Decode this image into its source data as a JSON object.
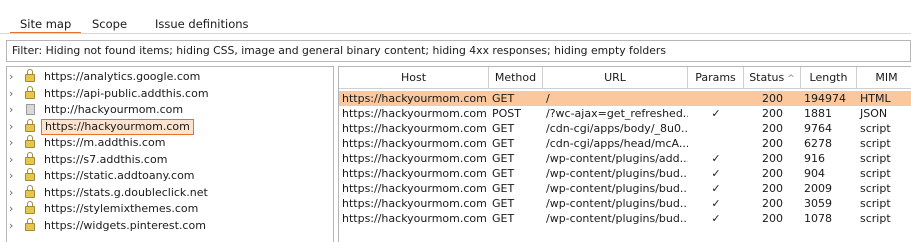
{
  "tabs": [
    {
      "label": "Site map",
      "active": true
    },
    {
      "label": "Scope",
      "active": false
    },
    {
      "label": "Issue definitions",
      "active": false
    }
  ],
  "filter": {
    "text": "Filter: Hiding not found items;  hiding CSS, image and general binary content;  hiding 4xx responses;  hiding empty folders"
  },
  "sitemap": {
    "hosts": [
      {
        "label": "https://analytics.google.com",
        "icon": "lock-icon",
        "selected": false
      },
      {
        "label": "https://api-public.addthis.com",
        "icon": "lock-icon",
        "selected": false
      },
      {
        "label": "http://hackyourmom.com",
        "icon": "page-icon",
        "selected": false
      },
      {
        "label": "https://hackyourmom.com",
        "icon": "lock-icon",
        "selected": true
      },
      {
        "label": "https://m.addthis.com",
        "icon": "lock-icon",
        "selected": false
      },
      {
        "label": "https://s7.addthis.com",
        "icon": "lock-icon",
        "selected": false
      },
      {
        "label": "https://static.addtoany.com",
        "icon": "lock-icon",
        "selected": false
      },
      {
        "label": "https://stats.g.doubleclick.net",
        "icon": "lock-icon",
        "selected": false
      },
      {
        "label": "https://stylemixthemes.com",
        "icon": "lock-icon",
        "selected": false
      },
      {
        "label": "https://widgets.pinterest.com",
        "icon": "lock-icon",
        "selected": false
      }
    ]
  },
  "requests": {
    "columns": [
      "Host",
      "Method",
      "URL",
      "Params",
      "Status",
      "Length",
      "MIM"
    ],
    "sort_indicator": "^",
    "rows": [
      {
        "host": "https://hackyourmom.com",
        "method": "GET",
        "url": "/",
        "params": "",
        "status": "200",
        "length": "194974",
        "mime": "HTML",
        "selected": true
      },
      {
        "host": "https://hackyourmom.com",
        "method": "POST",
        "url": "/?wc-ajax=get_refreshed...",
        "params": "✓",
        "status": "200",
        "length": "1881",
        "mime": "JSON",
        "selected": false
      },
      {
        "host": "https://hackyourmom.com",
        "method": "GET",
        "url": "/cdn-cgi/apps/body/_8u0...",
        "params": "",
        "status": "200",
        "length": "9764",
        "mime": "script",
        "selected": false
      },
      {
        "host": "https://hackyourmom.com",
        "method": "GET",
        "url": "/cdn-cgi/apps/head/mcA...",
        "params": "",
        "status": "200",
        "length": "6278",
        "mime": "script",
        "selected": false
      },
      {
        "host": "https://hackyourmom.com",
        "method": "GET",
        "url": "/wp-content/plugins/add...",
        "params": "✓",
        "status": "200",
        "length": "916",
        "mime": "script",
        "selected": false
      },
      {
        "host": "https://hackyourmom.com",
        "method": "GET",
        "url": "/wp-content/plugins/bud...",
        "params": "✓",
        "status": "200",
        "length": "904",
        "mime": "script",
        "selected": false
      },
      {
        "host": "https://hackyourmom.com",
        "method": "GET",
        "url": "/wp-content/plugins/bud...",
        "params": "✓",
        "status": "200",
        "length": "2009",
        "mime": "script",
        "selected": false
      },
      {
        "host": "https://hackyourmom.com",
        "method": "GET",
        "url": "/wp-content/plugins/bud...",
        "params": "✓",
        "status": "200",
        "length": "3059",
        "mime": "script",
        "selected": false
      },
      {
        "host": "https://hackyourmom.com",
        "method": "GET",
        "url": "/wp-content/plugins/bud...",
        "params": "✓",
        "status": "200",
        "length": "1078",
        "mime": "script",
        "selected": false
      }
    ]
  },
  "colors": {
    "accent": "#e8712a",
    "selected_row": "#fbc89e",
    "selected_host": "#fbe3cf"
  }
}
